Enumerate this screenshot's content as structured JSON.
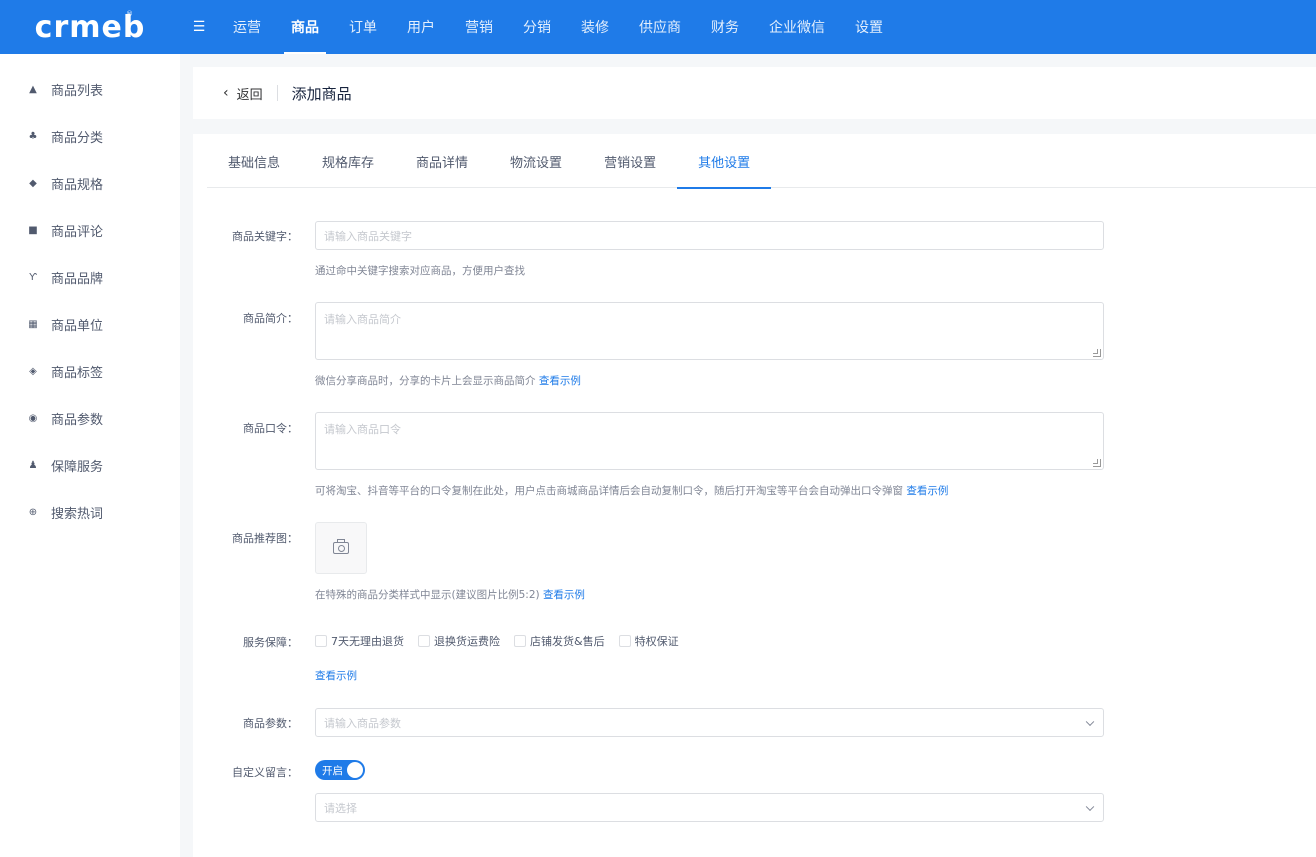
{
  "brand": {
    "logo": "crmeb",
    "reg": "®"
  },
  "topnav": {
    "items": [
      "运营",
      "商品",
      "订单",
      "用户",
      "营销",
      "分销",
      "装修",
      "供应商",
      "财务",
      "企业微信",
      "设置"
    ]
  },
  "sidebar": {
    "items": [
      {
        "label": "商品列表",
        "icon": "basket-icon"
      },
      {
        "label": "商品分类",
        "icon": "category-icon"
      },
      {
        "label": "商品规格",
        "icon": "cube-icon"
      },
      {
        "label": "商品评论",
        "icon": "comment-icon"
      },
      {
        "label": "商品品牌",
        "icon": "brand-icon"
      },
      {
        "label": "商品单位",
        "icon": "grid-icon"
      },
      {
        "label": "商品标签",
        "icon": "tag-icon"
      },
      {
        "label": "商品参数",
        "icon": "eye-icon"
      },
      {
        "label": "保障服务",
        "icon": "person-icon"
      },
      {
        "label": "搜索热词",
        "icon": "globe-icon"
      }
    ]
  },
  "header": {
    "back": "返回",
    "title": "添加商品"
  },
  "tabs": [
    "基础信息",
    "规格库存",
    "商品详情",
    "物流设置",
    "营销设置",
    "其他设置"
  ],
  "form": {
    "keyword": {
      "label": "商品关键字：",
      "placeholder": "请输入商品关键字",
      "hint": "通过命中关键字搜索对应商品，方便用户查找"
    },
    "intro": {
      "label": "商品简介：",
      "placeholder": "请输入商品简介",
      "hint": "微信分享商品时，分享的卡片上会显示商品简介",
      "link": "查看示例"
    },
    "token": {
      "label": "商品口令：",
      "placeholder": "请输入商品口令",
      "hint": "可将淘宝、抖音等平台的口令复制在此处，用户点击商城商品详情后会自动复制口令，随后打开淘宝等平台会自动弹出口令弹窗",
      "link": "查看示例"
    },
    "recommend": {
      "label": "商品推荐图：",
      "hint": "在特殊的商品分类样式中显示(建议图片比例5:2)",
      "link": "查看示例"
    },
    "service": {
      "label": "服务保障：",
      "options": [
        "7天无理由退货",
        "退换货运费险",
        "店铺发货&售后",
        "特权保证"
      ],
      "link": "查看示例"
    },
    "params": {
      "label": "商品参数：",
      "placeholder": "请输入商品参数"
    },
    "custom": {
      "label": "自定义留言：",
      "switch_text": "开启",
      "select_placeholder": "请选择"
    }
  },
  "colors": {
    "primary": "#1f7be8"
  }
}
